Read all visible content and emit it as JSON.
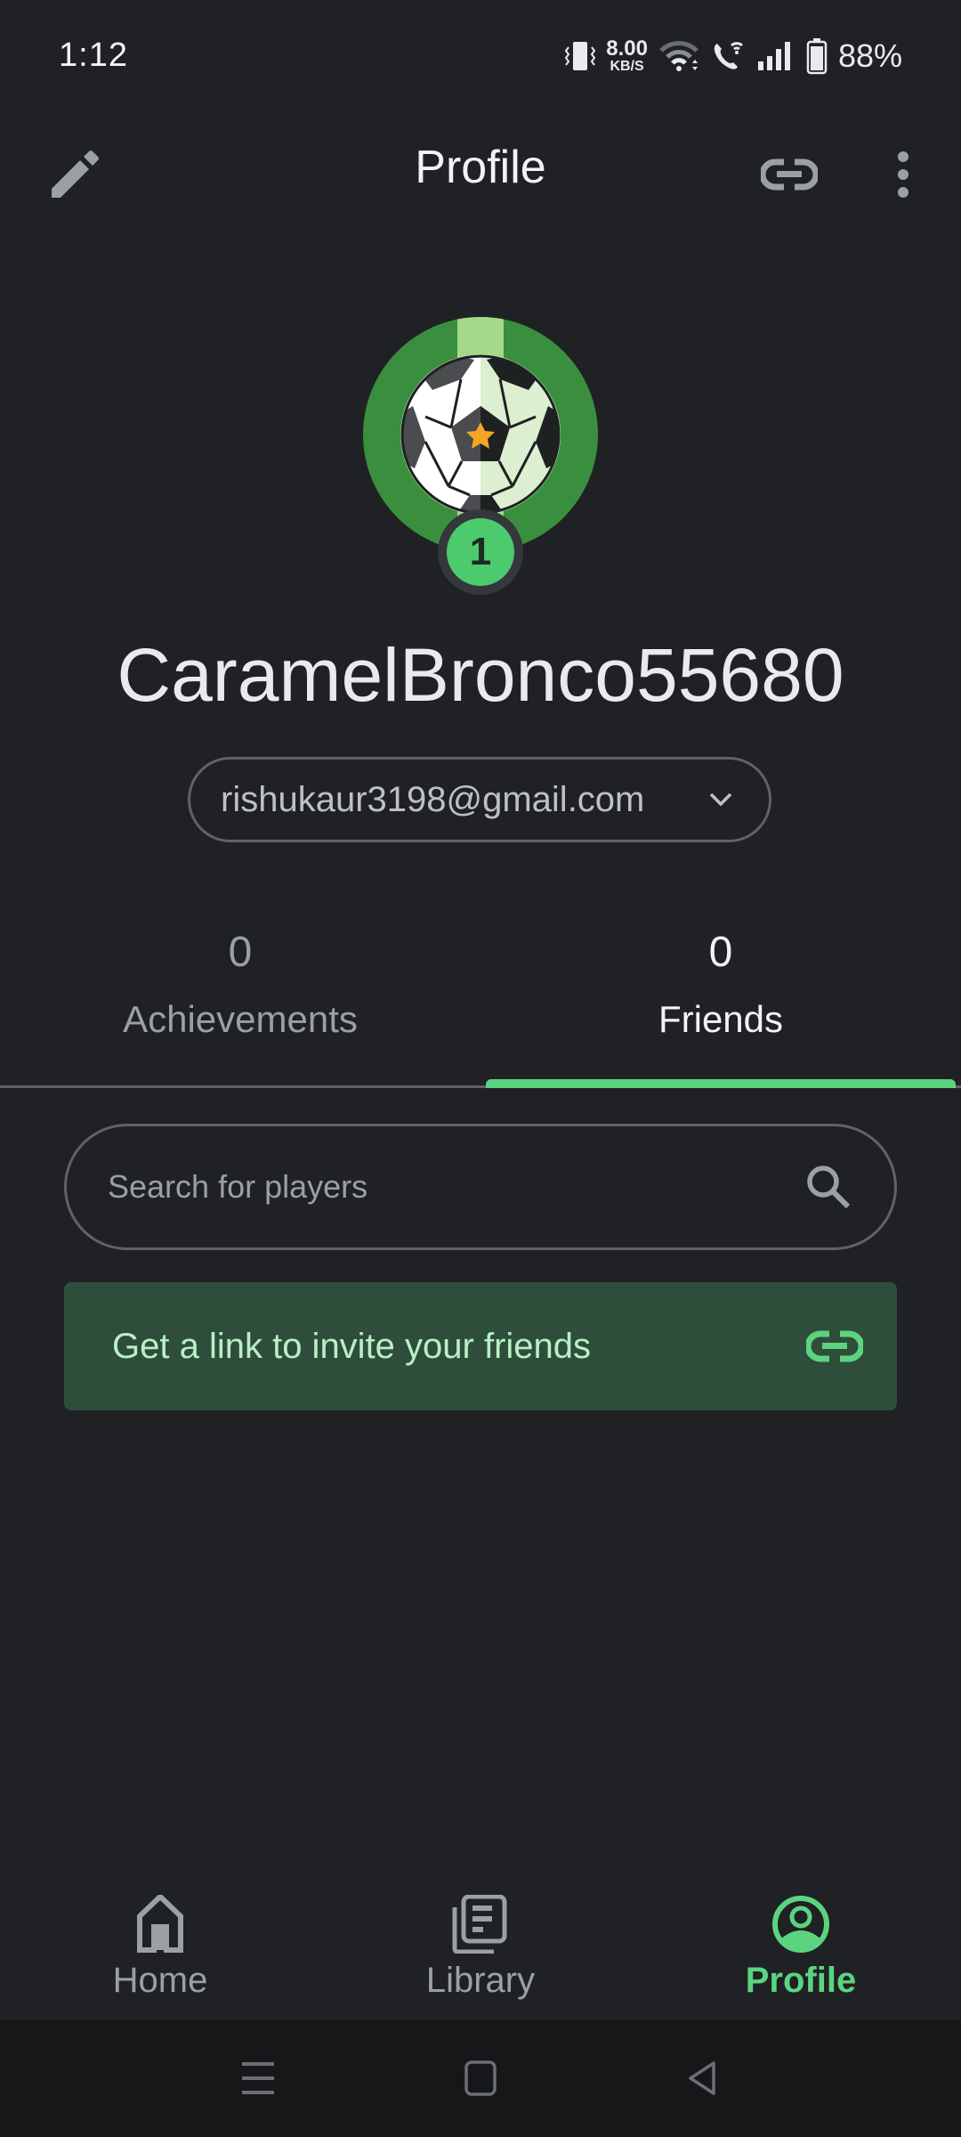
{
  "status_bar": {
    "time": "1:12",
    "net_speed_value": "8.00",
    "net_speed_unit": "KB/S",
    "battery_percent": "88%",
    "icons": [
      "vibrate-icon",
      "wifi-icon",
      "wifi-calling-icon",
      "signal-icon",
      "battery-icon"
    ]
  },
  "app_bar": {
    "title": "Profile",
    "edit_icon": "pencil-icon",
    "link_icon": "link-icon",
    "more_icon": "more-vert-icon"
  },
  "profile": {
    "avatar": "soccer-ball-avatar",
    "level": "1",
    "username": "CaramelBronco55680",
    "email": "rishukaur3198@gmail.com"
  },
  "tabs": [
    {
      "count": "0",
      "label": "Achievements",
      "active": false
    },
    {
      "count": "0",
      "label": "Friends",
      "active": true
    }
  ],
  "search": {
    "placeholder": "Search for players",
    "value": ""
  },
  "invite": {
    "label": "Get a link to invite your friends"
  },
  "bottom_nav": [
    {
      "label": "Home",
      "icon": "home-icon",
      "active": false
    },
    {
      "label": "Library",
      "icon": "library-icon",
      "active": false
    },
    {
      "label": "Profile",
      "icon": "profile-icon",
      "active": true
    }
  ],
  "system_nav": [
    "recents-button",
    "home-button",
    "back-button"
  ],
  "colors": {
    "background": "#202124",
    "accent": "#5bd47f",
    "invite_card": "#2f4d3b",
    "invite_text": "#b8f0c6"
  }
}
